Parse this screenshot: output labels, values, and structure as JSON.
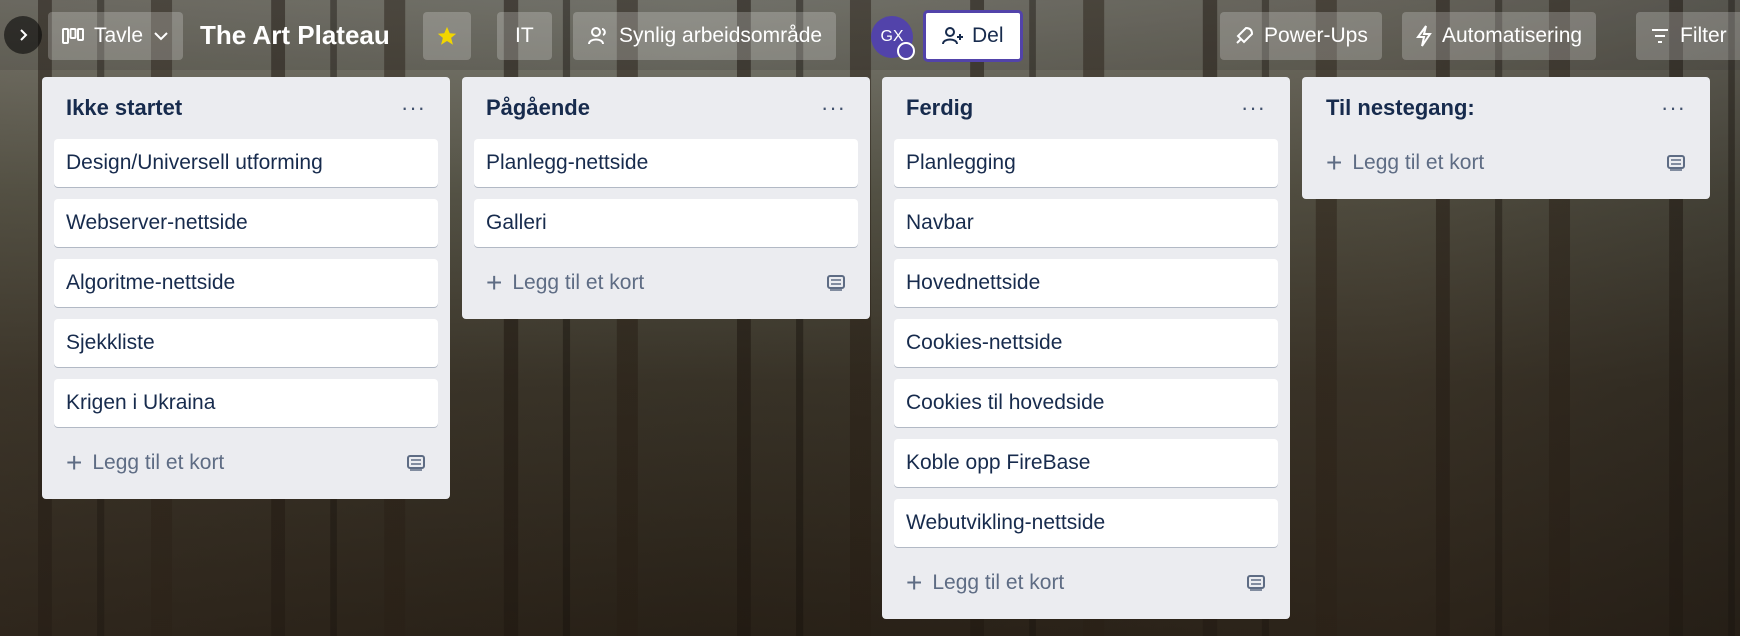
{
  "topbar": {
    "board_switch_label": "Tavle",
    "board_title": "The Art Plateau",
    "workspace_label": "IT",
    "visibility_label": "Synlig arbeidsområde",
    "avatar_initials": "GX",
    "share_label": "Del",
    "powerups_label": "Power-Ups",
    "automation_label": "Automatisering",
    "filter_label": "Filter",
    "star_color": "#f2d600",
    "avatar_color": "#5243aa"
  },
  "lists": [
    {
      "title": "Ikke startet",
      "cards": [
        "Design/Universell utforming",
        "Webserver-nettside",
        "Algoritme-nettside",
        "Sjekkliste",
        "Krigen i Ukraina"
      ],
      "add_label": "Legg til et kort"
    },
    {
      "title": "Pågående",
      "cards": [
        "Planlegg-nettside",
        "Galleri"
      ],
      "add_label": "Legg til et kort"
    },
    {
      "title": "Ferdig",
      "cards": [
        "Planlegging",
        "Navbar",
        "Hovednettside",
        "Cookies-nettside",
        "Cookies til hovedside",
        "Koble opp FireBase",
        "Webutvikling-nettside"
      ],
      "add_label": "Legg til et kort"
    },
    {
      "title": "Til nestegang:",
      "cards": [],
      "add_label": "Legg til et kort"
    }
  ],
  "list_menu_glyph": "···"
}
